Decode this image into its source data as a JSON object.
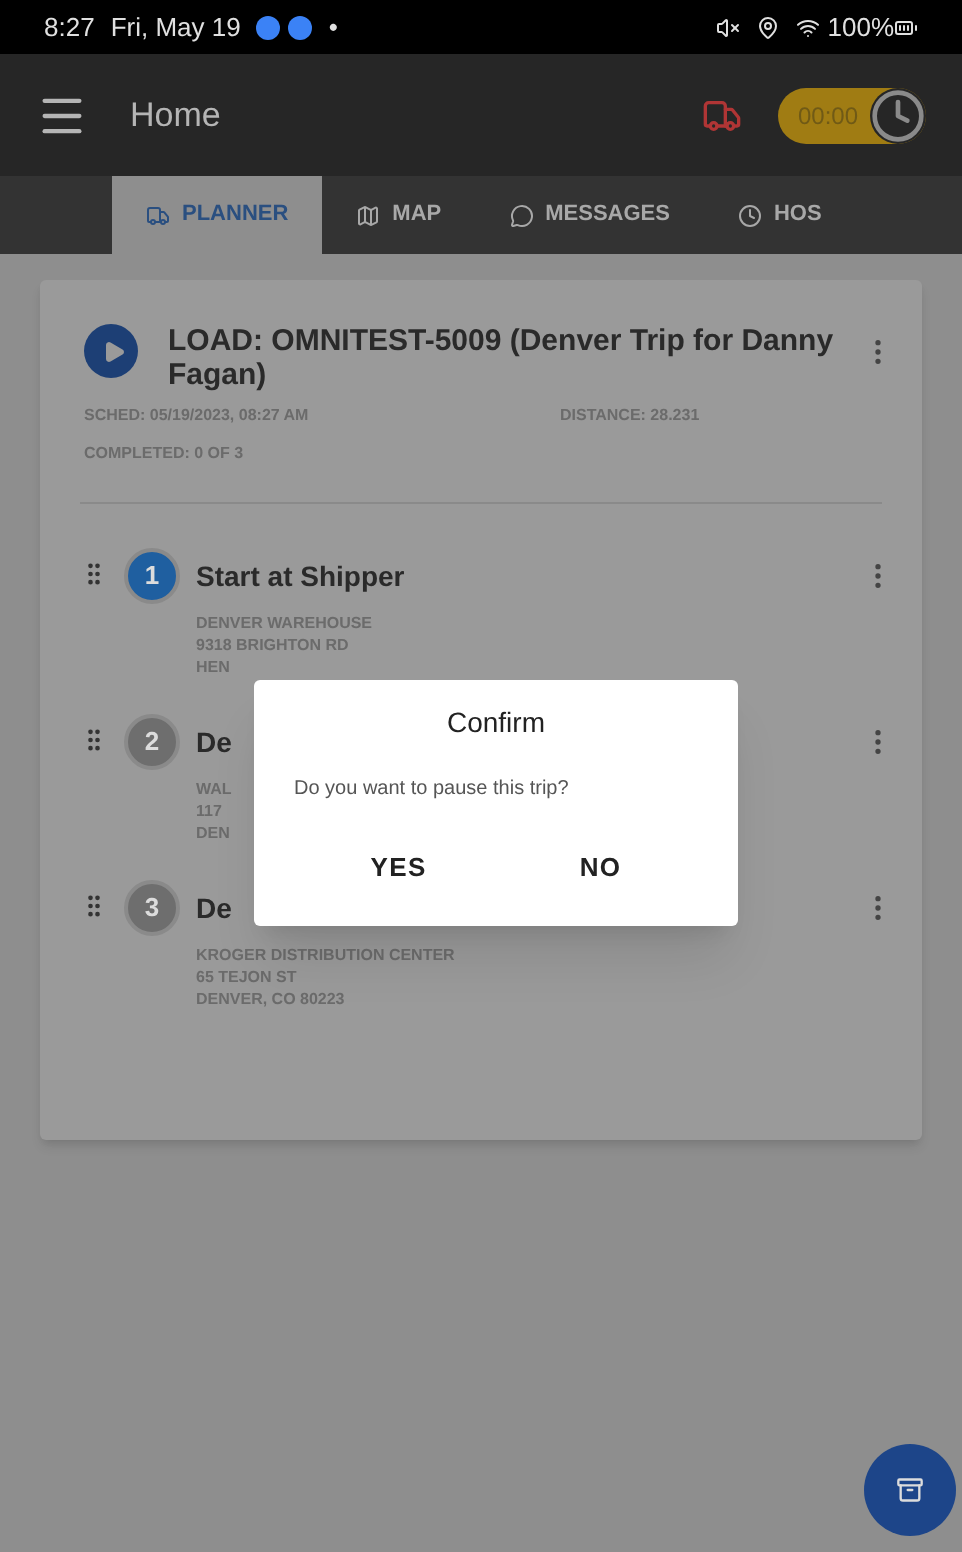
{
  "status_bar": {
    "time": "8:27",
    "date": "Fri, May 19",
    "dot": "•",
    "battery": "100%"
  },
  "app_bar": {
    "title": "Home",
    "timer": "00:00"
  },
  "tabs": [
    {
      "label": "PLANNER",
      "kind": "truck",
      "selected": true
    },
    {
      "label": "MAP",
      "kind": "map",
      "selected": false
    },
    {
      "label": "MESSAGES",
      "kind": "chat",
      "selected": false
    },
    {
      "label": "HOS",
      "kind": "clock",
      "selected": false
    }
  ],
  "load": {
    "title": "LOAD: OMNITEST-5009 (Denver Trip for Danny Fagan)",
    "sched": "SCHED: 05/19/2023, 08:27 AM",
    "distance": "DISTANCE: 28.231",
    "completed": "COMPLETED: 0 OF 3"
  },
  "stops": [
    {
      "number": "1",
      "current": true,
      "title": "Start at Shipper",
      "lines": [
        "DENVER WAREHOUSE",
        "9318 BRIGHTON RD",
        "HEN"
      ]
    },
    {
      "number": "2",
      "current": false,
      "title": "De",
      "lines": [
        "WAL",
        "117",
        "DEN"
      ]
    },
    {
      "number": "3",
      "current": false,
      "title": "De",
      "lines": [
        "KROGER DISTRIBUTION CENTER",
        "65 TEJON ST",
        "DENVER, CO 80223"
      ]
    }
  ],
  "dialog": {
    "title": "Confirm",
    "message": "Do you want to pause this trip?",
    "buttons": [
      "YES",
      "NO"
    ]
  }
}
